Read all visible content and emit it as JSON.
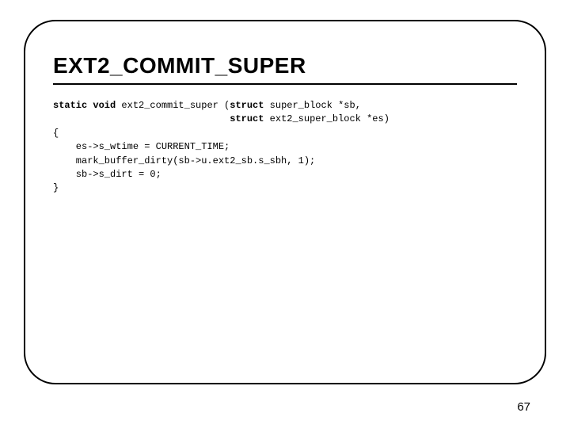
{
  "slide": {
    "title": "EXT2_COMMIT_SUPER",
    "page_number": "67"
  },
  "code": {
    "sig_kw1": "static void",
    "sig_fn": " ext2_commit_super (",
    "sig_kw2": "struct",
    "sig_p1": " super_block *sb,",
    "sig_indent": "                               ",
    "sig_kw3": "struct",
    "sig_p2": " ext2_super_block *es)",
    "brace_open": "{",
    "body1": "    es->s_wtime = CURRENT_TIME;",
    "body2": "    mark_buffer_dirty(sb->u.ext2_sb.s_sbh, 1);",
    "body3": "    sb->s_dirt = 0;",
    "brace_close": "}"
  }
}
